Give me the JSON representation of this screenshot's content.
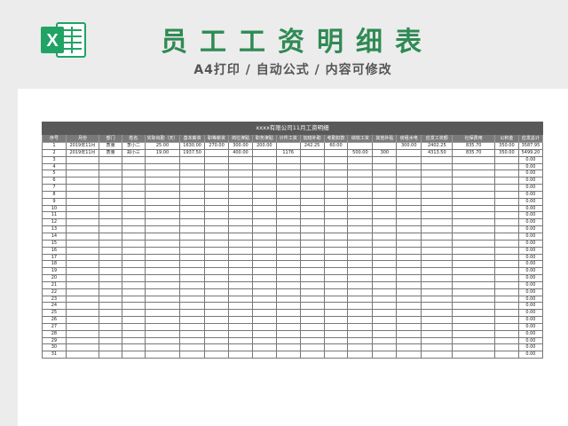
{
  "header": {
    "title": "员工工资明细表",
    "subtitle": "A4打印 / 自动公式 / 内容可修改",
    "logo_icon": "excel-icon",
    "accent_color": "#2f8a54",
    "logo_color": "#21a366"
  },
  "table": {
    "banner": "xxxx有限公司11月工资明细",
    "columns": [
      "序号",
      "月份",
      "部门",
      "姓名",
      "实际出勤（天）",
      "基本薪资",
      "职等薪资",
      "岗位津贴",
      "职务津贴",
      "计件工资",
      "加班补助",
      "考勤扣款",
      "绩效工资",
      "其他补贴",
      "房租水电",
      "应发工资额",
      "社保费用",
      "公积金",
      "应发总计"
    ],
    "rows": [
      [
        "1",
        "2019年11月",
        "质量",
        "李小二",
        "25.00",
        "1630.00",
        "270.00",
        "300.00",
        "200.00",
        "",
        "242.25",
        "60.00",
        "",
        "",
        "300.00",
        "2402.25",
        "835.70",
        "350.00",
        "3587.95"
      ],
      [
        "2",
        "2019年11月",
        "质量",
        "郑小三",
        "19.00",
        "1937.50",
        "",
        "400.00",
        "",
        "1176",
        "",
        "",
        "500.00",
        "300",
        "",
        "4313.50",
        "835.70",
        "350.00",
        "5499.20"
      ],
      [
        "3",
        "",
        "",
        "",
        "",
        "",
        "",
        "",
        "",
        "",
        "",
        "",
        "",
        "",
        "",
        "",
        "",
        "",
        "0.00"
      ],
      [
        "4",
        "",
        "",
        "",
        "",
        "",
        "",
        "",
        "",
        "",
        "",
        "",
        "",
        "",
        "",
        "",
        "",
        "",
        "0.00"
      ],
      [
        "5",
        "",
        "",
        "",
        "",
        "",
        "",
        "",
        "",
        "",
        "",
        "",
        "",
        "",
        "",
        "",
        "",
        "",
        "0.00"
      ],
      [
        "6",
        "",
        "",
        "",
        "",
        "",
        "",
        "",
        "",
        "",
        "",
        "",
        "",
        "",
        "",
        "",
        "",
        "",
        "0.00"
      ],
      [
        "7",
        "",
        "",
        "",
        "",
        "",
        "",
        "",
        "",
        "",
        "",
        "",
        "",
        "",
        "",
        "",
        "",
        "",
        "0.00"
      ],
      [
        "8",
        "",
        "",
        "",
        "",
        "",
        "",
        "",
        "",
        "",
        "",
        "",
        "",
        "",
        "",
        "",
        "",
        "",
        "0.00"
      ],
      [
        "9",
        "",
        "",
        "",
        "",
        "",
        "",
        "",
        "",
        "",
        "",
        "",
        "",
        "",
        "",
        "",
        "",
        "",
        "0.00"
      ],
      [
        "10",
        "",
        "",
        "",
        "",
        "",
        "",
        "",
        "",
        "",
        "",
        "",
        "",
        "",
        "",
        "",
        "",
        "",
        "0.00"
      ],
      [
        "11",
        "",
        "",
        "",
        "",
        "",
        "",
        "",
        "",
        "",
        "",
        "",
        "",
        "",
        "",
        "",
        "",
        "",
        "0.00"
      ],
      [
        "12",
        "",
        "",
        "",
        "",
        "",
        "",
        "",
        "",
        "",
        "",
        "",
        "",
        "",
        "",
        "",
        "",
        "",
        "0.00"
      ],
      [
        "13",
        "",
        "",
        "",
        "",
        "",
        "",
        "",
        "",
        "",
        "",
        "",
        "",
        "",
        "",
        "",
        "",
        "",
        "0.00"
      ],
      [
        "14",
        "",
        "",
        "",
        "",
        "",
        "",
        "",
        "",
        "",
        "",
        "",
        "",
        "",
        "",
        "",
        "",
        "",
        "0.00"
      ],
      [
        "15",
        "",
        "",
        "",
        "",
        "",
        "",
        "",
        "",
        "",
        "",
        "",
        "",
        "",
        "",
        "",
        "",
        "",
        "0.00"
      ],
      [
        "16",
        "",
        "",
        "",
        "",
        "",
        "",
        "",
        "",
        "",
        "",
        "",
        "",
        "",
        "",
        "",
        "",
        "",
        "0.00"
      ],
      [
        "17",
        "",
        "",
        "",
        "",
        "",
        "",
        "",
        "",
        "",
        "",
        "",
        "",
        "",
        "",
        "",
        "",
        "",
        "0.00"
      ],
      [
        "18",
        "",
        "",
        "",
        "",
        "",
        "",
        "",
        "",
        "",
        "",
        "",
        "",
        "",
        "",
        "",
        "",
        "",
        "0.00"
      ],
      [
        "19",
        "",
        "",
        "",
        "",
        "",
        "",
        "",
        "",
        "",
        "",
        "",
        "",
        "",
        "",
        "",
        "",
        "",
        "0.00"
      ],
      [
        "20",
        "",
        "",
        "",
        "",
        "",
        "",
        "",
        "",
        "",
        "",
        "",
        "",
        "",
        "",
        "",
        "",
        "",
        "0.00"
      ],
      [
        "21",
        "",
        "",
        "",
        "",
        "",
        "",
        "",
        "",
        "",
        "",
        "",
        "",
        "",
        "",
        "",
        "",
        "",
        "0.00"
      ],
      [
        "22",
        "",
        "",
        "",
        "",
        "",
        "",
        "",
        "",
        "",
        "",
        "",
        "",
        "",
        "",
        "",
        "",
        "",
        "0.00"
      ],
      [
        "23",
        "",
        "",
        "",
        "",
        "",
        "",
        "",
        "",
        "",
        "",
        "",
        "",
        "",
        "",
        "",
        "",
        "",
        "0.00"
      ],
      [
        "24",
        "",
        "",
        "",
        "",
        "",
        "",
        "",
        "",
        "",
        "",
        "",
        "",
        "",
        "",
        "",
        "",
        "",
        "0.00"
      ],
      [
        "25",
        "",
        "",
        "",
        "",
        "",
        "",
        "",
        "",
        "",
        "",
        "",
        "",
        "",
        "",
        "",
        "",
        "",
        "0.00"
      ],
      [
        "26",
        "",
        "",
        "",
        "",
        "",
        "",
        "",
        "",
        "",
        "",
        "",
        "",
        "",
        "",
        "",
        "",
        "",
        "0.00"
      ],
      [
        "27",
        "",
        "",
        "",
        "",
        "",
        "",
        "",
        "",
        "",
        "",
        "",
        "",
        "",
        "",
        "",
        "",
        "",
        "0.00"
      ],
      [
        "28",
        "",
        "",
        "",
        "",
        "",
        "",
        "",
        "",
        "",
        "",
        "",
        "",
        "",
        "",
        "",
        "",
        "",
        "0.00"
      ],
      [
        "29",
        "",
        "",
        "",
        "",
        "",
        "",
        "",
        "",
        "",
        "",
        "",
        "",
        "",
        "",
        "",
        "",
        "",
        "0.00"
      ],
      [
        "30",
        "",
        "",
        "",
        "",
        "",
        "",
        "",
        "",
        "",
        "",
        "",
        "",
        "",
        "",
        "",
        "",
        "",
        "0.00"
      ],
      [
        "31",
        "",
        "",
        "",
        "",
        "",
        "",
        "",
        "",
        "",
        "",
        "",
        "",
        "",
        "",
        "",
        "",
        "",
        "0.00"
      ]
    ]
  }
}
